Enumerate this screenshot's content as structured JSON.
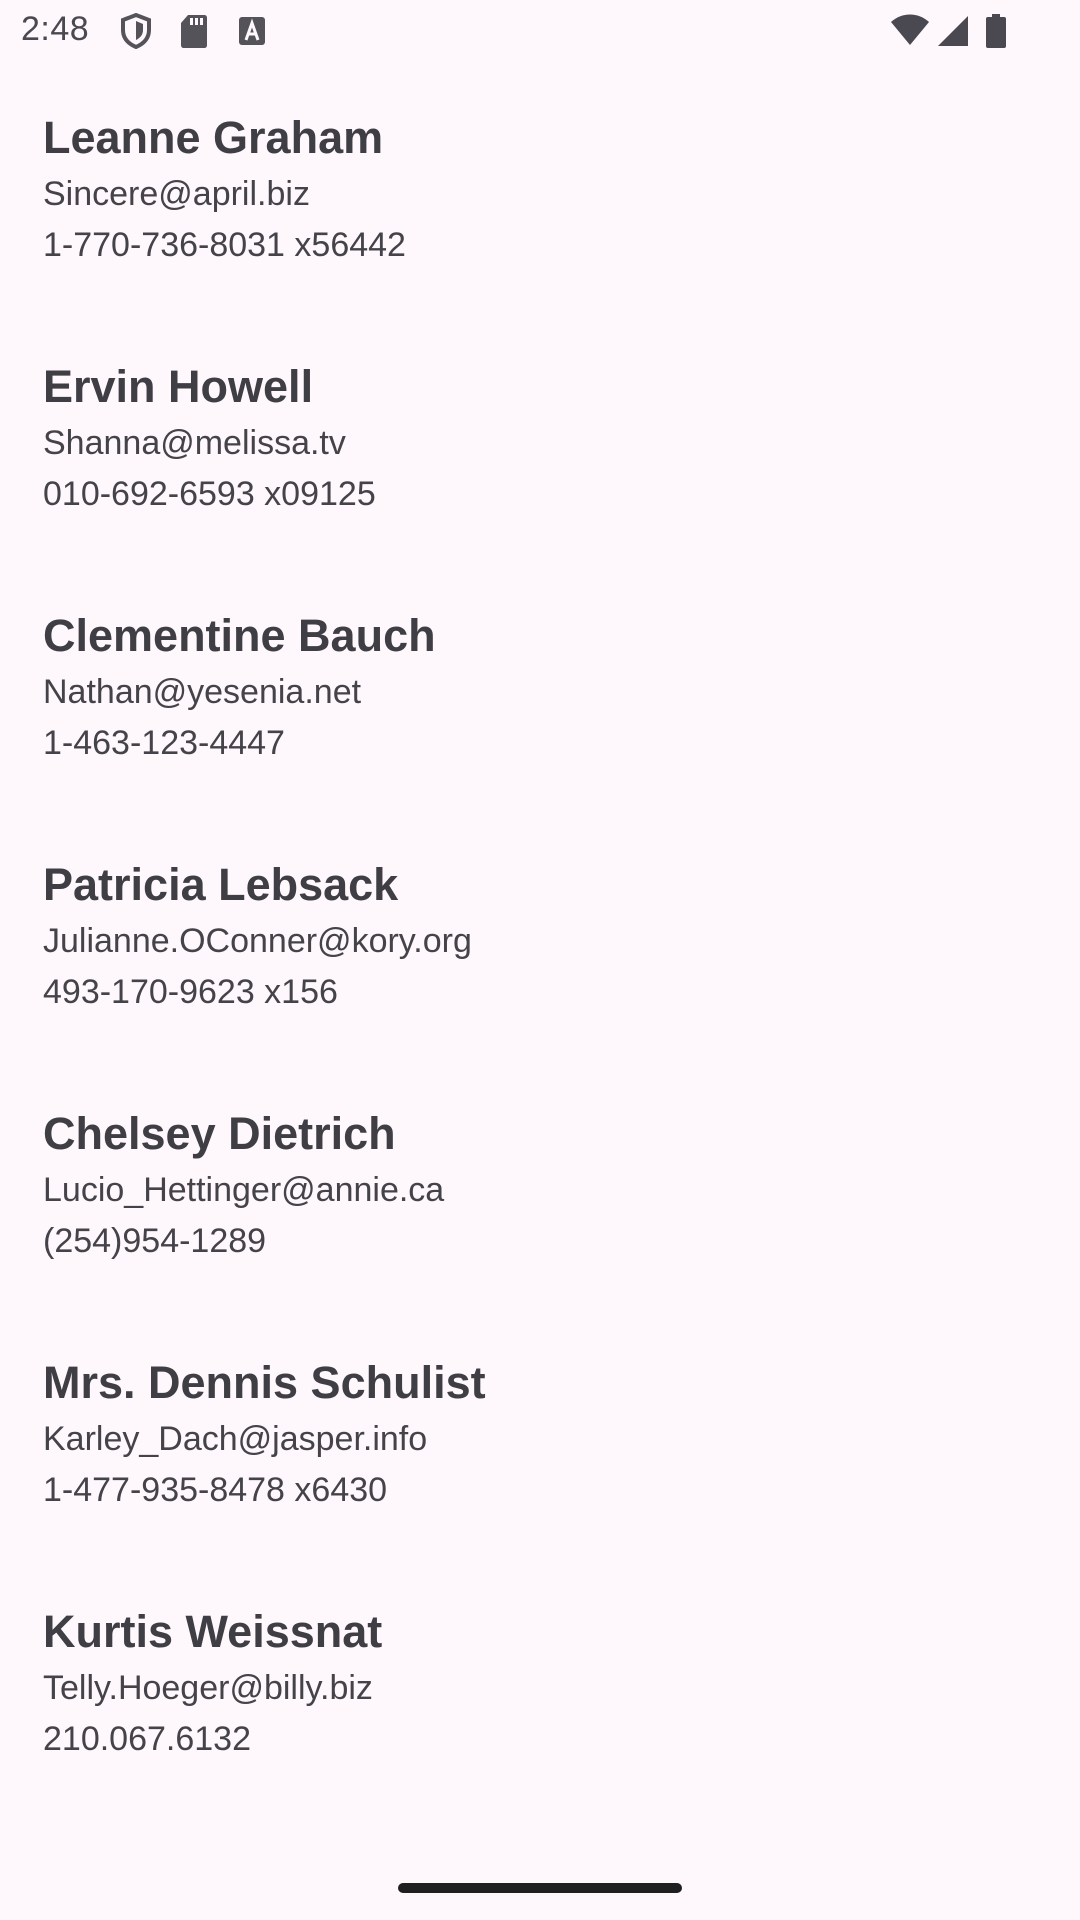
{
  "status_bar": {
    "time": "2:48",
    "left_icons": [
      "shield-icon",
      "sd-card-icon",
      "text-a-icon"
    ],
    "right_icons": [
      "wifi-icon",
      "cell-signal-icon",
      "battery-icon"
    ]
  },
  "contacts": [
    {
      "name": "Leanne Graham",
      "email": "Sincere@april.biz",
      "phone": "1-770-736-8031 x56442"
    },
    {
      "name": "Ervin Howell",
      "email": "Shanna@melissa.tv",
      "phone": "010-692-6593 x09125"
    },
    {
      "name": "Clementine Bauch",
      "email": "Nathan@yesenia.net",
      "phone": "1-463-123-4447"
    },
    {
      "name": "Patricia Lebsack",
      "email": "Julianne.OConner@kory.org",
      "phone": "493-170-9623 x156"
    },
    {
      "name": "Chelsey Dietrich",
      "email": "Lucio_Hettinger@annie.ca",
      "phone": "(254)954-1289"
    },
    {
      "name": "Mrs. Dennis Schulist",
      "email": "Karley_Dach@jasper.info",
      "phone": "1-477-935-8478 x6430"
    },
    {
      "name": "Kurtis Weissnat",
      "email": "Telly.Hoeger@billy.biz",
      "phone": "210.067.6132"
    }
  ],
  "colors": {
    "background": "#fef7fb",
    "text": "#3f3e45",
    "home_indicator": "#1f1f1f"
  }
}
